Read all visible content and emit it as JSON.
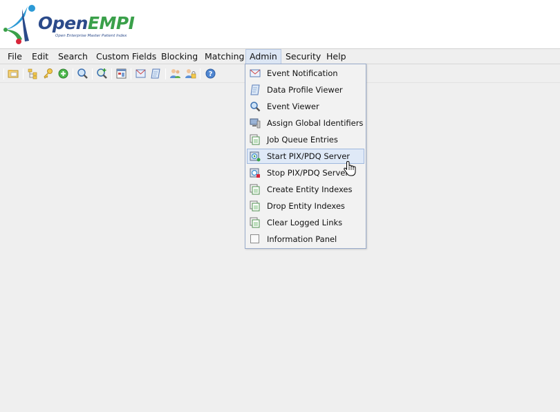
{
  "logo": {
    "brand_open": "Open",
    "brand_empi": "EMPI",
    "tagline": "Open Enterprise Master Patient Index"
  },
  "menubar": {
    "items": [
      {
        "label": "File"
      },
      {
        "label": "Edit"
      },
      {
        "label": "Search"
      },
      {
        "label": "Custom Fields"
      },
      {
        "label": "Blocking"
      },
      {
        "label": "Matching"
      },
      {
        "label": "Admin"
      },
      {
        "label": "Security"
      },
      {
        "label": "Help"
      }
    ],
    "active": "Admin"
  },
  "toolbar": {
    "icons": [
      "open-folder-icon",
      "hierarchy-icon",
      "key-icon",
      "add-circle-icon",
      "search-icon",
      "search-plus-icon",
      "report-icon",
      "event-notification-icon",
      "data-profile-icon",
      "users-icon",
      "user-lock-icon",
      "help-icon"
    ]
  },
  "admin_menu": {
    "items": [
      {
        "label": "Event Notification",
        "icon": "event-notification-icon"
      },
      {
        "label": "Data Profile Viewer",
        "icon": "data-profile-icon"
      },
      {
        "label": "Event Viewer",
        "icon": "magnifier-icon"
      },
      {
        "label": "Assign Global Identifiers",
        "icon": "computer-icon"
      },
      {
        "label": "Job Queue Entries",
        "icon": "pages-icon"
      },
      {
        "label": "Start PIX/PDQ Server",
        "icon": "server-start-icon"
      },
      {
        "label": "Stop PIX/PDQ Server",
        "icon": "server-stop-icon"
      },
      {
        "label": "Create Entity Indexes",
        "icon": "pages-icon"
      },
      {
        "label": "Drop Entity Indexes",
        "icon": "pages-icon"
      },
      {
        "label": "Clear Logged Links",
        "icon": "pages-icon"
      },
      {
        "label": "Information Panel",
        "icon": "checkbox-icon"
      }
    ],
    "hovered": "Start PIX/PDQ Server"
  },
  "colors": {
    "menu_active_bg": "#dce6f4",
    "dropdown_border": "#97a9c9",
    "brand_blue": "#2b4a8a",
    "brand_green": "#3aa04a"
  }
}
